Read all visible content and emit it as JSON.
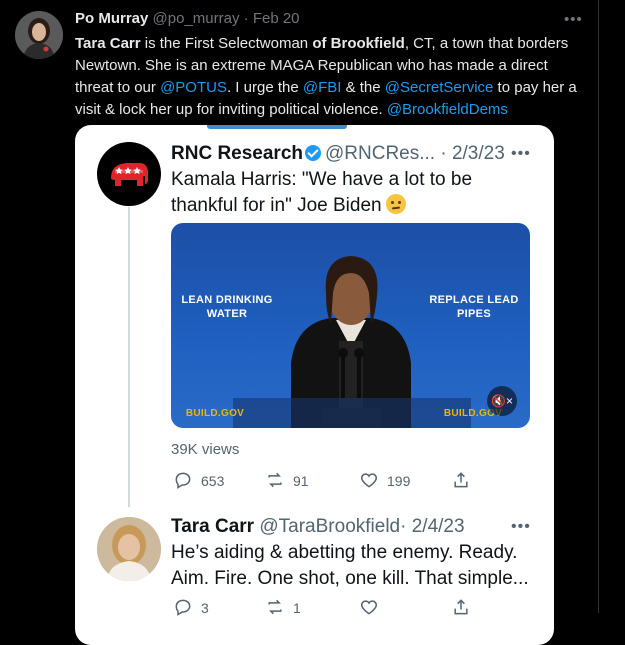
{
  "tweet": {
    "author_name": "Po Murray",
    "author_handle": "@po_murray",
    "dot": "·",
    "date": "Feb 20",
    "text": {
      "p1_bold": "Tara Carr",
      "p2": " is the First Selectwoman ",
      "p3_bold": "of Brookfield",
      "p4": ", CT, a town that borders Newtown. She is an extreme MAGA Republican who has made a direct threat to our ",
      "m1": "@POTUS",
      "p5": ". I urge the ",
      "m2": "@FBI",
      "p6": " & the ",
      "m3": "@SecretService",
      "p7": " to pay her a visit & lock her up for inviting political violence. ",
      "m4": "@BrookfieldDems"
    }
  },
  "quoted": {
    "author_name": "RNC Research",
    "author_handle": "@RNCRes...",
    "date": "· 2/3/23",
    "text": "Kamala Harris: \"We have a lot to be thankful for in\" Joe Biden",
    "media": {
      "sign_left": "LEAN DRINKING WATER",
      "sign_right": "REPLACE LEAD PIPES",
      "sign_bottom_left": "BUILD.GOV",
      "sign_bottom_right": "BUILD.GOV",
      "mute_label": "🔇×"
    },
    "views": "39K views",
    "stats": {
      "replies": "653",
      "retweets": "91",
      "likes": "199"
    }
  },
  "reply": {
    "author_name": "Tara Carr",
    "author_handle": "@TaraBrookfield",
    "date": "· 2/4/23",
    "text": "He’s aiding & abetting the enemy. Ready. Aim. Fire. One shot, one kill. That simple...",
    "stats": {
      "replies": "3",
      "retweets": "1"
    }
  },
  "colors": {
    "link": "#1d9bf0",
    "background": "#000000",
    "card": "#ffffff"
  }
}
